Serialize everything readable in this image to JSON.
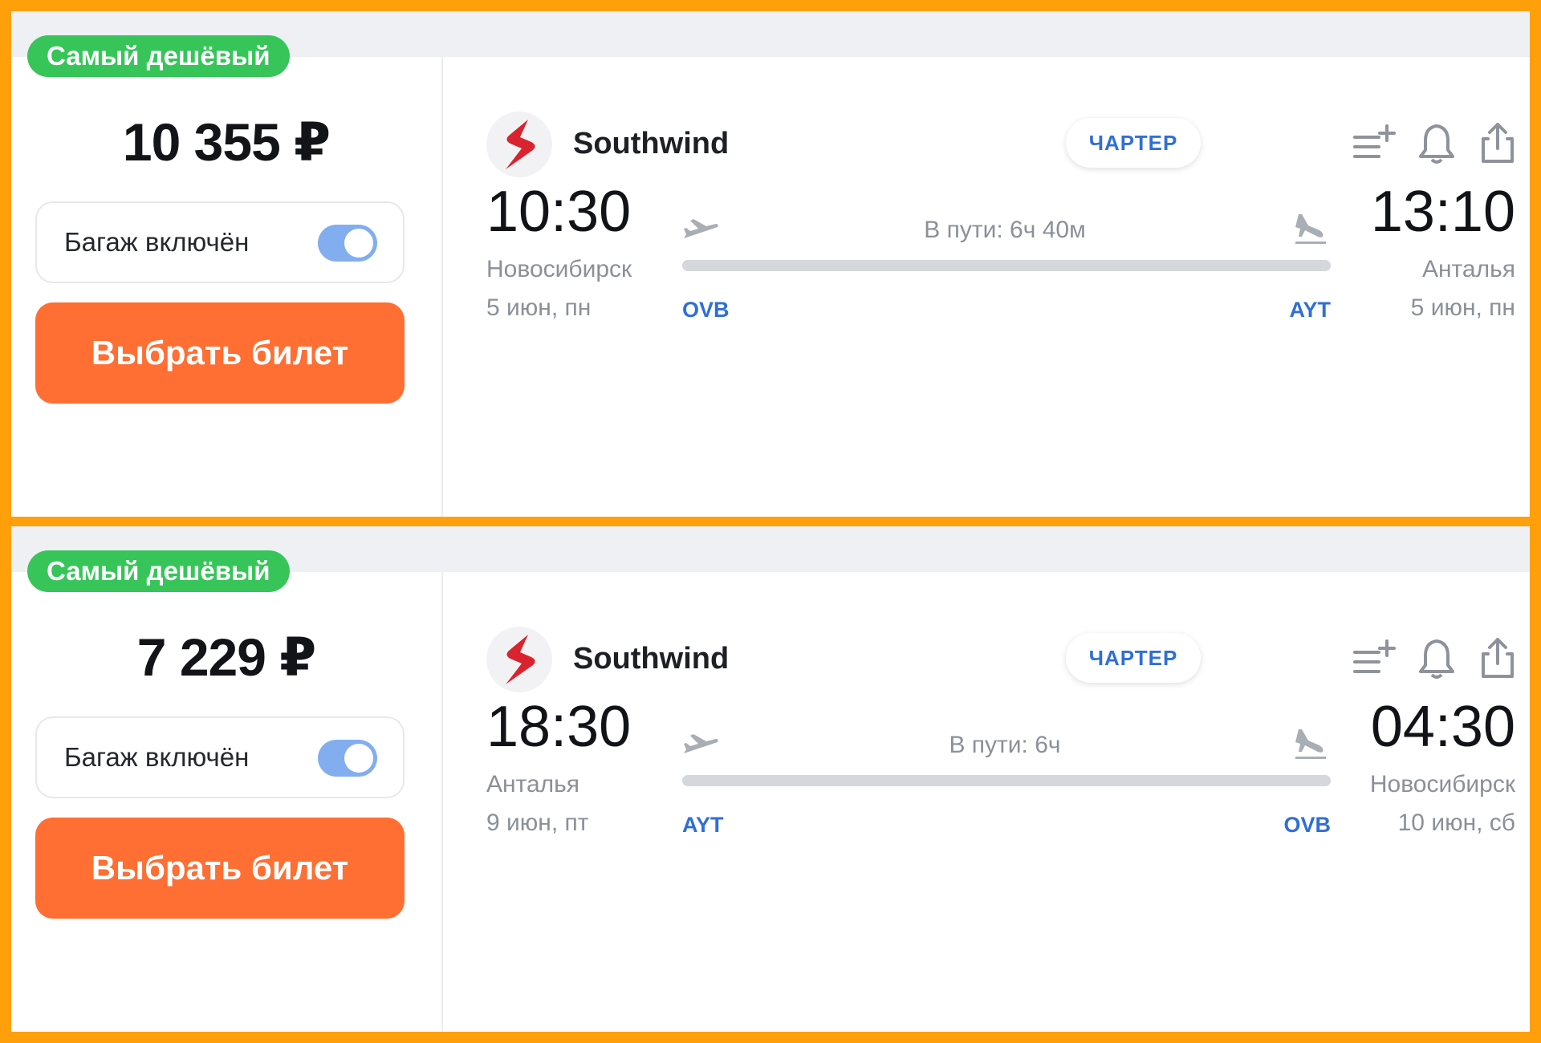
{
  "tickets": [
    {
      "badge": "Самый дешёвый",
      "price": "10 355 ₽",
      "baggage_label": "Багаж включён",
      "baggage_included": true,
      "select_button": "Выбрать билет",
      "airline": "Southwind",
      "charter_label": "ЧАРТЕР",
      "departure_time": "10:30",
      "arrival_time": "13:10",
      "departure_city": "Новосибирск",
      "arrival_city": "Анталья",
      "departure_date": "5 июн, пн",
      "arrival_date": "5 июн, пн",
      "duration": "В пути: 6ч 40м",
      "from_code": "OVB",
      "to_code": "AYT"
    },
    {
      "badge": "Самый дешёвый",
      "price": "7 229 ₽",
      "baggage_label": "Багаж включён",
      "baggage_included": true,
      "select_button": "Выбрать билет",
      "airline": "Southwind",
      "charter_label": "ЧАРТЕР",
      "departure_time": "18:30",
      "arrival_time": "04:30",
      "departure_city": "Анталья",
      "arrival_city": "Новосибирск",
      "departure_date": "9 июн, пт",
      "arrival_date": "10 июн, сб",
      "duration": "В пути: 6ч",
      "from_code": "AYT",
      "to_code": "OVB"
    }
  ],
  "colors": {
    "frame": "#ff9f0a",
    "badge": "#37c55a",
    "button": "#ff6e33",
    "toggle": "#82aef0",
    "accent_blue": "#2f6fd6",
    "logo_red": "#d9232e"
  },
  "icons": {
    "airline_logo": "southwind-logo",
    "filter": "playlist-add-icon",
    "subscribe": "bell-icon",
    "share": "share-icon",
    "takeoff": "takeoff-plane-icon",
    "landing": "landing-plane-icon"
  }
}
